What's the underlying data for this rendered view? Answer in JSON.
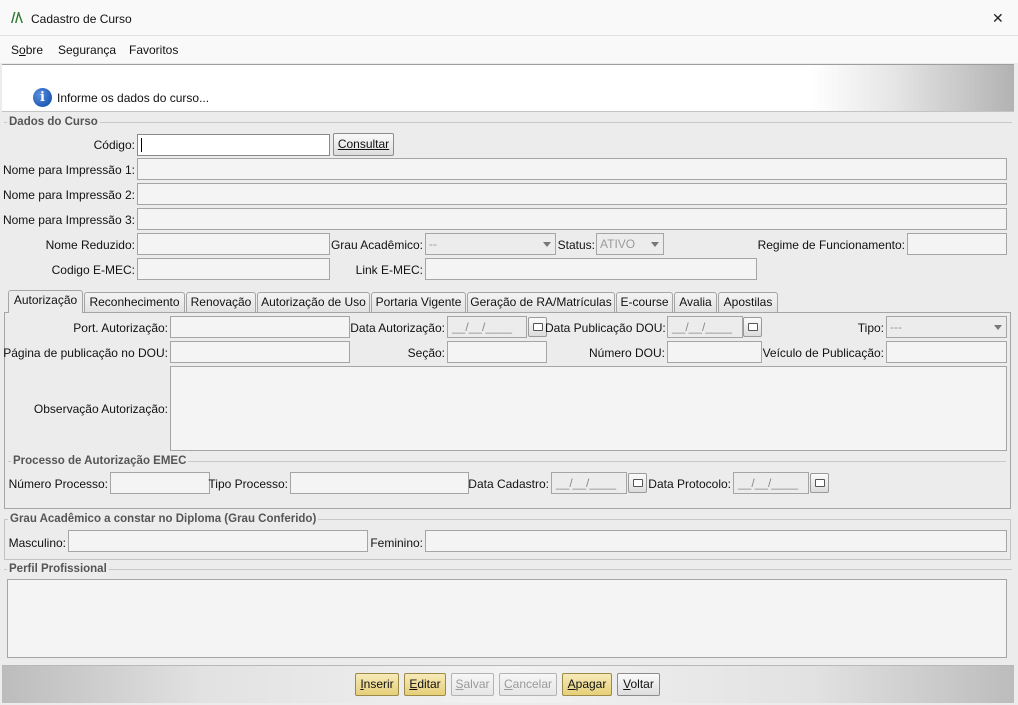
{
  "window": {
    "title": "Cadastro de Curso",
    "close_glyph": "✕"
  },
  "menu": {
    "sobre": {
      "pre": "S",
      "u": "o",
      "post": "bre"
    },
    "seguranca": "Segurança",
    "favoritos": "Favoritos"
  },
  "info": {
    "text": "Informe os dados do curso...",
    "icon": "info-icon",
    "icon_glyph": "i"
  },
  "dados": {
    "group_title": "Dados do Curso",
    "codigo_label": "Código:",
    "consultar_label": "Consultar",
    "nome1_label": "Nome para Impressão 1:",
    "nome2_label": "Nome para Impressão 2:",
    "nome3_label": "Nome para Impressão 3:",
    "nome_reduzido_label": "Nome Reduzido:",
    "grau_label": "Grau Acadêmico:",
    "grau_value": "--",
    "status_label": "Status:",
    "status_value": "ATIVO",
    "regime_label": "Regime de Funcionamento:",
    "emec_label": "Codigo E-MEC:",
    "link_label": "Link E-MEC:"
  },
  "tabs": [
    "Autorização",
    "Reconhecimento",
    "Renovação",
    "Autorização de Uso",
    "Portaria Vigente",
    "Geração de RA/Matrículas",
    "E-course",
    "Avalia",
    "Apostilas"
  ],
  "autorizacao": {
    "port_label": "Port. Autorização:",
    "data_aut_label": "Data Autorização:",
    "data_aut_value": "__/__/____",
    "data_pub_label": "Data Publicação DOU:",
    "data_pub_value": "__/__/____",
    "tipo_label": "Tipo:",
    "tipo_value": "---",
    "pagina_label": "Página de publicação no DOU:",
    "secao_label": "Seção:",
    "numero_dou_label": "Número DOU:",
    "veiculo_label": "Veículo de Publicação:",
    "obs_label": "Observação Autorização:",
    "processo_title": "Processo de Autorização EMEC",
    "num_proc_label": "Número Processo:",
    "tipo_proc_label": "Tipo Processo:",
    "data_cad_label": "Data Cadastro:",
    "data_cad_value": "__/__/____",
    "data_prot_label": "Data Protocolo:",
    "data_prot_value": "__/__/____"
  },
  "grau_conferido": {
    "title": "Grau Acadêmico a constar no Diploma (Grau Conferido)",
    "masc_label": "Masculino:",
    "fem_label": "Feminino:"
  },
  "perfil": {
    "title": "Perfil Profissional"
  },
  "buttons": {
    "inserir": {
      "u": "I",
      "rest": "nserir"
    },
    "editar": {
      "u": "E",
      "rest": "ditar"
    },
    "salvar": {
      "u": "S",
      "rest": "alvar"
    },
    "cancelar": {
      "u": "C",
      "rest": "ancelar"
    },
    "apagar": {
      "u": "A",
      "rest": "pagar"
    },
    "voltar": {
      "u": "V",
      "rest": "oltar"
    }
  },
  "colors": {
    "accent_gold": "#e6cf78",
    "info_blue": "#1f5bb5",
    "logo_green": "#2e7d32"
  }
}
